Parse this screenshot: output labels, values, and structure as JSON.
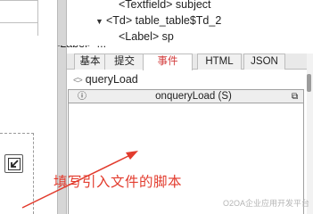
{
  "tree": {
    "row1": "<Textfield> subject",
    "row2": "<Td> table_table$Td_2",
    "row3": "<Label> sp"
  },
  "tabs": [
    {
      "label": "基本"
    },
    {
      "label": "提交"
    },
    {
      "label": "事件",
      "active": true
    },
    {
      "label": "HTML"
    },
    {
      "label": "JSON"
    }
  ],
  "script": {
    "name": "queryLoad",
    "event_title": "onqueryLoad (S)"
  },
  "annotation": {
    "text": "填写引入文件的脚本",
    "color": "#e23b2d"
  },
  "watermark": "O2OA企业应用开发平台",
  "colors": {
    "active_tab_text": "#d23a3a",
    "annotation_arrow": "#e23b2d"
  },
  "icons": [
    "arrow-down-icon",
    "code-icon",
    "info-icon",
    "restore-icon",
    "fit-to-window-icon"
  ]
}
